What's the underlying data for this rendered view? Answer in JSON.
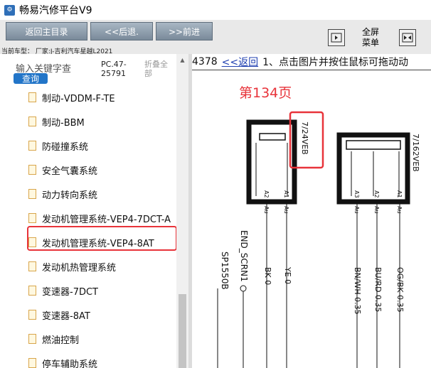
{
  "app": {
    "title": "畅易汽修平台V9",
    "icon_name": "app-logo-icon"
  },
  "toolbar": {
    "home_label": "返回主目录",
    "back_label": "<<后退.",
    "forward_label": ">>前进",
    "car_info": "当前车型： 厂家:J-吉利汽车星越L2021",
    "fullscreen_label": "全屏\n菜单",
    "fullscreen_line1": "全屏",
    "fullscreen_line2": "菜单"
  },
  "sidebar": {
    "search_placeholder": "输入关键字查",
    "query_label": "查询",
    "pc_code": "PC.47-25791",
    "fold_all_label": "折叠全部",
    "items": [
      {
        "label": "制动-VDDM-F-TE"
      },
      {
        "label": "制动-BBM"
      },
      {
        "label": "防碰撞系统"
      },
      {
        "label": "安全气囊系统"
      },
      {
        "label": "动力转向系统"
      },
      {
        "label": "发动机管理系统-VEP4-7DCT-A"
      },
      {
        "label": "发动机管理系统-VEP4-8AT"
      },
      {
        "label": "发动机热管理系统"
      },
      {
        "label": "变速器-7DCT"
      },
      {
        "label": "变速器-8AT"
      },
      {
        "label": "燃油控制"
      },
      {
        "label": "停车辅助系统"
      }
    ],
    "selected_index": 6
  },
  "main": {
    "nav_prefix": "4378",
    "back_link": "<<返回",
    "instruction": "1、点击图片并按住鼠标可拖动动",
    "page_label": "第134页",
    "diagram": {
      "connector_left": "7/24VEB",
      "connector_right": "7/162VEB",
      "pins_left": [
        "A2",
        "A1"
      ],
      "pins_right": [
        "A3",
        "A2",
        "A1"
      ],
      "pin_type": "Au",
      "wires": [
        {
          "label": "SP1550B"
        },
        {
          "label": "END_SCRN1"
        },
        {
          "label": "BK 0"
        },
        {
          "label": "YE 0"
        },
        {
          "label": "BN/WH 0.35"
        },
        {
          "label": "BU/RD 0.35"
        },
        {
          "label": "OG/BK 0.35"
        }
      ]
    }
  },
  "colors": {
    "highlight": "#e8333a",
    "link": "#1f3fb0",
    "button": "#8a99a8",
    "query": "#2275c8"
  }
}
